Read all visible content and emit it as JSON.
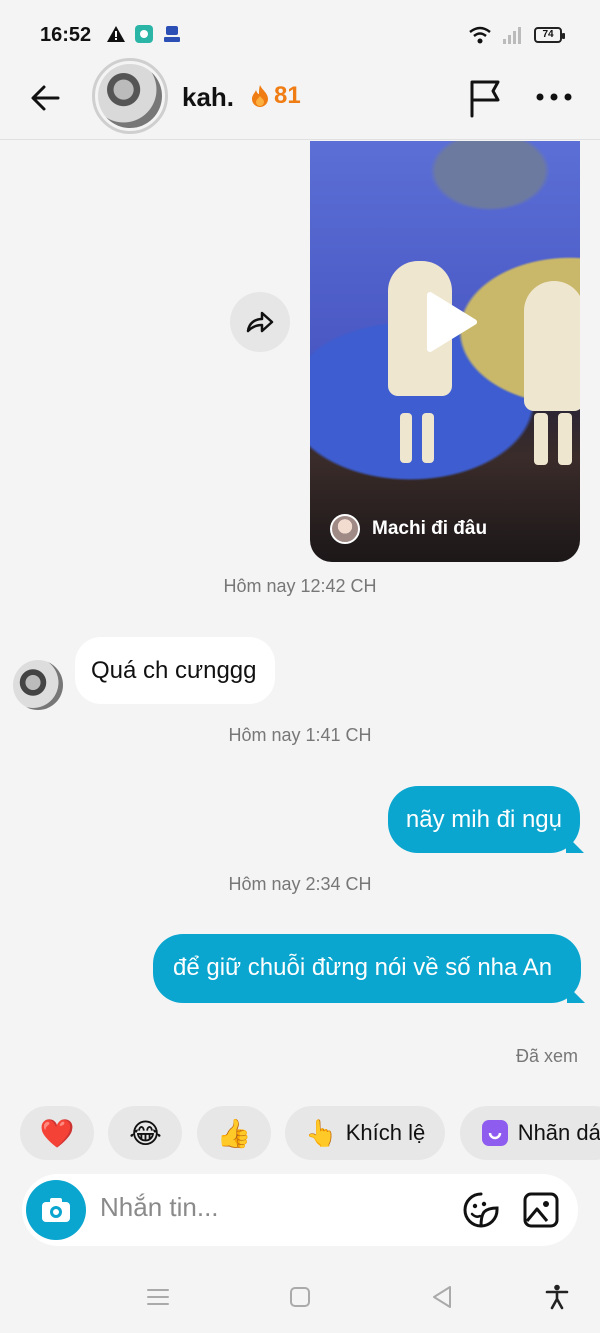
{
  "status_bar": {
    "time": "16:52",
    "battery": "74"
  },
  "header": {
    "name": "kah.",
    "streak_count": "81",
    "streak_icon": "fire-icon"
  },
  "video": {
    "caption": "Machi đi đâu"
  },
  "messages": [
    {
      "timestamp": "Hôm nay 12:42 CH"
    },
    {
      "text": "Quá ch cưnggg",
      "direction": "in"
    },
    {
      "timestamp": "Hôm nay 1:41 CH"
    },
    {
      "text": "nãy mih đi ngụ",
      "direction": "out"
    },
    {
      "timestamp": "Hôm nay 2:34 CH"
    },
    {
      "text": "để giữ chuỗi đừng nói về số nha An",
      "direction": "out"
    }
  ],
  "seen_label": "Đã xem",
  "quick_reactions": [
    {
      "emoji": "❤️",
      "label": ""
    },
    {
      "emoji": "😂",
      "label": ""
    },
    {
      "emoji": "👍",
      "label": ""
    },
    {
      "emoji": "👆",
      "label": "Khích lệ"
    },
    {
      "emoji": "",
      "label": "Nhãn dá"
    }
  ],
  "composer": {
    "placeholder": "Nhắn tin..."
  },
  "colors": {
    "accent": "#0aa6cf",
    "streak": "#f07d14",
    "background": "#f4f4f4"
  }
}
